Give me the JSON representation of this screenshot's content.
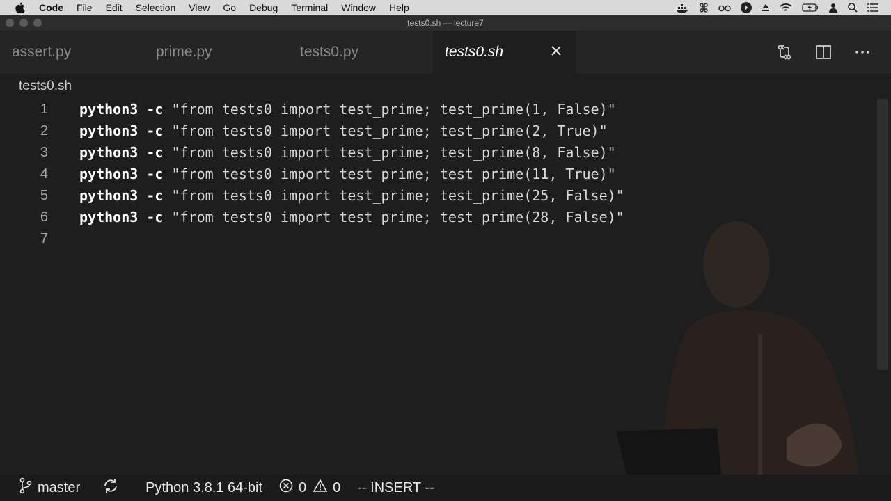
{
  "menubar": {
    "app": "Code",
    "items": [
      "File",
      "Edit",
      "Selection",
      "View",
      "Go",
      "Debug",
      "Terminal",
      "Window",
      "Help"
    ]
  },
  "window": {
    "title": "tests0.sh — lecture7"
  },
  "tabs": [
    {
      "label": "assert.py",
      "active": false
    },
    {
      "label": "prime.py",
      "active": false
    },
    {
      "label": "tests0.py",
      "active": false
    },
    {
      "label": "tests0.sh",
      "active": true
    }
  ],
  "breadcrumb": "tests0.sh",
  "editor": {
    "lines": [
      {
        "number": "1",
        "cmd": "python3",
        "flag": "-c",
        "arg": "\"from tests0 import test_prime; test_prime(1, False)\""
      },
      {
        "number": "2",
        "cmd": "python3",
        "flag": "-c",
        "arg": "\"from tests0 import test_prime; test_prime(2, True)\""
      },
      {
        "number": "3",
        "cmd": "python3",
        "flag": "-c",
        "arg": "\"from tests0 import test_prime; test_prime(8, False)\""
      },
      {
        "number": "4",
        "cmd": "python3",
        "flag": "-c",
        "arg": "\"from tests0 import test_prime; test_prime(11, True)\""
      },
      {
        "number": "5",
        "cmd": "python3",
        "flag": "-c",
        "arg": "\"from tests0 import test_prime; test_prime(25, False)\""
      },
      {
        "number": "6",
        "cmd": "python3",
        "flag": "-c",
        "arg": "\"from tests0 import test_prime; test_prime(28, False)\""
      },
      {
        "number": "7",
        "cmd": "",
        "flag": "",
        "arg": ""
      }
    ]
  },
  "statusbar": {
    "branch": "master",
    "interpreter": "Python 3.8.1 64-bit",
    "errors": "0",
    "warnings": "0",
    "mode": "-- INSERT --"
  },
  "icons": {
    "branch": "git-branch-icon",
    "sync": "sync-icon",
    "error": "error-circle-icon",
    "warning": "warning-triangle-icon",
    "close": "close-icon",
    "compare": "compare-changes-icon",
    "split": "split-editor-icon",
    "more": "more-actions-icon"
  }
}
